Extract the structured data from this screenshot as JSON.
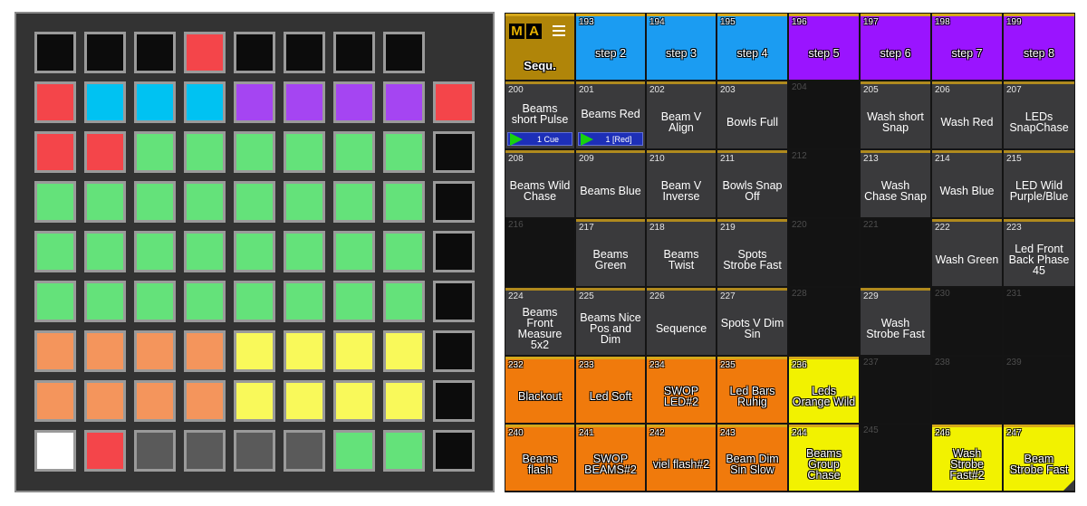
{
  "launchpad": {
    "colors": {
      "K": "#0c0c0c",
      "R": "#f4454a",
      "C": "#00c2f2",
      "P": "#a545f2",
      "G": "#64e27a",
      "O": "#f4955c",
      "Y": "#f9f95a",
      "W": "#ffffff",
      "D": "#5a5a5a"
    },
    "top_row": [
      "K",
      "K",
      "K",
      "R",
      "K",
      "K",
      "K",
      "K"
    ],
    "rows": [
      [
        "R",
        "C",
        "C",
        "C",
        "P",
        "P",
        "P",
        "P",
        "R"
      ],
      [
        "R",
        "R",
        "G",
        "G",
        "G",
        "G",
        "G",
        "G",
        "K"
      ],
      [
        "G",
        "G",
        "G",
        "G",
        "G",
        "G",
        "G",
        "G",
        "K"
      ],
      [
        "G",
        "G",
        "G",
        "G",
        "G",
        "G",
        "G",
        "G",
        "K"
      ],
      [
        "G",
        "G",
        "G",
        "G",
        "G",
        "G",
        "G",
        "G",
        "K"
      ],
      [
        "O",
        "O",
        "O",
        "O",
        "Y",
        "Y",
        "Y",
        "Y",
        "K"
      ],
      [
        "O",
        "O",
        "O",
        "O",
        "Y",
        "Y",
        "Y",
        "Y",
        "K"
      ],
      [
        "W",
        "R",
        "D",
        "D",
        "D",
        "D",
        "G",
        "G",
        "K"
      ]
    ]
  },
  "ma": {
    "logo": [
      "M",
      "A"
    ],
    "seq_label": "Sequ.",
    "cells": [
      {
        "n": "193",
        "t": "step 2",
        "c": "blue",
        "o": true
      },
      {
        "n": "194",
        "t": "step 3",
        "c": "blue",
        "o": true
      },
      {
        "n": "195",
        "t": "step 4",
        "c": "blue",
        "o": true
      },
      {
        "n": "196",
        "t": "step 5",
        "c": "purple",
        "o": true
      },
      {
        "n": "197",
        "t": "step 6",
        "c": "purple",
        "o": true
      },
      {
        "n": "198",
        "t": "step 7",
        "c": "purple",
        "o": true
      },
      {
        "n": "199",
        "t": "step 8",
        "c": "purple",
        "o": true
      },
      {
        "n": "200",
        "t": "Beams\nshort Pulse",
        "c": "gray",
        "cue": "1 Cue"
      },
      {
        "n": "201",
        "t": "Beams Red",
        "c": "gray",
        "cue": "1 [Red]"
      },
      {
        "n": "202",
        "t": "Beam V\nAlign",
        "c": "gray"
      },
      {
        "n": "203",
        "t": "Bowls Full",
        "c": "gray"
      },
      {
        "n": "204",
        "t": "",
        "c": "empty"
      },
      {
        "n": "205",
        "t": "Wash short\nSnap",
        "c": "gray"
      },
      {
        "n": "206",
        "t": "Wash Red",
        "c": "gray"
      },
      {
        "n": "207",
        "t": "LEDs\nSnapChase",
        "c": "gray"
      },
      {
        "n": "208",
        "t": "Beams Wild\nChase",
        "c": "gray"
      },
      {
        "n": "209",
        "t": "Beams Blue",
        "c": "gray"
      },
      {
        "n": "210",
        "t": "Beam V\nInverse",
        "c": "gray"
      },
      {
        "n": "211",
        "t": "Bowls Snap\nOff",
        "c": "gray"
      },
      {
        "n": "212",
        "t": "",
        "c": "empty"
      },
      {
        "n": "213",
        "t": "Wash\nChase Snap",
        "c": "gray"
      },
      {
        "n": "214",
        "t": "Wash Blue",
        "c": "gray"
      },
      {
        "n": "215",
        "t": "LED Wild\nPurple/Blue",
        "c": "gray"
      },
      {
        "n": "216",
        "t": "",
        "c": "empty"
      },
      {
        "n": "217",
        "t": "Beams\nGreen",
        "c": "gray"
      },
      {
        "n": "218",
        "t": "Beams\nTwist",
        "c": "gray"
      },
      {
        "n": "219",
        "t": "Spots\nStrobe Fast",
        "c": "gray"
      },
      {
        "n": "220",
        "t": "",
        "c": "empty"
      },
      {
        "n": "221",
        "t": "",
        "c": "empty"
      },
      {
        "n": "222",
        "t": "Wash Green",
        "c": "gray"
      },
      {
        "n": "223",
        "t": "Led Front\nBack Phase\n45",
        "c": "gray"
      },
      {
        "n": "224",
        "t": "Beams\nFront\nMeasure\n5x2",
        "c": "gray"
      },
      {
        "n": "225",
        "t": "Beams Nice\nPos and\nDim",
        "c": "gray"
      },
      {
        "n": "226",
        "t": "Sequence",
        "c": "gray"
      },
      {
        "n": "227",
        "t": "Spots V Dim\nSin",
        "c": "gray"
      },
      {
        "n": "228",
        "t": "",
        "c": "empty"
      },
      {
        "n": "229",
        "t": "Wash\nStrobe Fast",
        "c": "gray"
      },
      {
        "n": "230",
        "t": "",
        "c": "empty"
      },
      {
        "n": "231",
        "t": "",
        "c": "empty"
      },
      {
        "n": "232",
        "t": "Blackout",
        "c": "orange",
        "o": true
      },
      {
        "n": "233",
        "t": "Led Soft",
        "c": "orange",
        "o": true
      },
      {
        "n": "234",
        "t": "SWOP\nLED#2",
        "c": "orange",
        "o": true
      },
      {
        "n": "235",
        "t": "Led Bars\nRuhig",
        "c": "orange",
        "o": true
      },
      {
        "n": "236",
        "t": "Leds\nOrange Wild",
        "c": "yellow",
        "o": true
      },
      {
        "n": "237",
        "t": "",
        "c": "empty"
      },
      {
        "n": "238",
        "t": "",
        "c": "empty"
      },
      {
        "n": "239",
        "t": "",
        "c": "empty"
      },
      {
        "n": "240",
        "t": "Beams\nflash",
        "c": "orange",
        "o": true
      },
      {
        "n": "241",
        "t": "SWOP\nBEAMS#2",
        "c": "orange",
        "o": true
      },
      {
        "n": "242",
        "t": "viel flash#2",
        "c": "orange",
        "o": true
      },
      {
        "n": "243",
        "t": "Beam Dim\nSin Slow",
        "c": "orange",
        "o": true
      },
      {
        "n": "244",
        "t": "Beams\nGroup\nChase",
        "c": "yellow",
        "o": true
      },
      {
        "n": "245",
        "t": "",
        "c": "empty"
      },
      {
        "n": "246",
        "t": "Wash\nStrobe\nFast#2",
        "c": "yellow",
        "o": true
      },
      {
        "n": "247",
        "t": "Beam\nStrobe Fast",
        "c": "yellow",
        "o": true
      }
    ]
  }
}
